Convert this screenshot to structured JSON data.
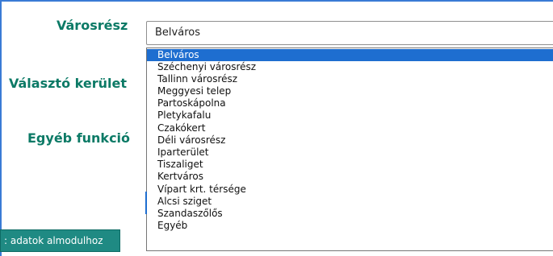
{
  "form": {
    "district_label": "Városrész",
    "voting_district_label": "Választó kerület",
    "other_function_label": "Egyéb funkció"
  },
  "district_select": {
    "selected_value": "Belváros",
    "options": [
      "Belváros",
      "Széchenyi városrész",
      "Tallinn városrész",
      "Meggyesi telep",
      "Partoskápolna",
      "Pletykafalu",
      "Czakókert",
      "Déli városrész",
      "Iparterület",
      "Tiszaliget",
      "Kertváros",
      "Vípart krt. térsége",
      "Alcsi sziget",
      "Szandaszőlős",
      "Egyéb"
    ]
  },
  "buttons": {
    "module_data_label": ": adatok almodulhoz"
  },
  "colors": {
    "label_text": "#0c7a66",
    "selected_option_bg": "#1e6ed0",
    "button_bg": "#1f8a83",
    "frame_accent": "#3a7bd5"
  }
}
